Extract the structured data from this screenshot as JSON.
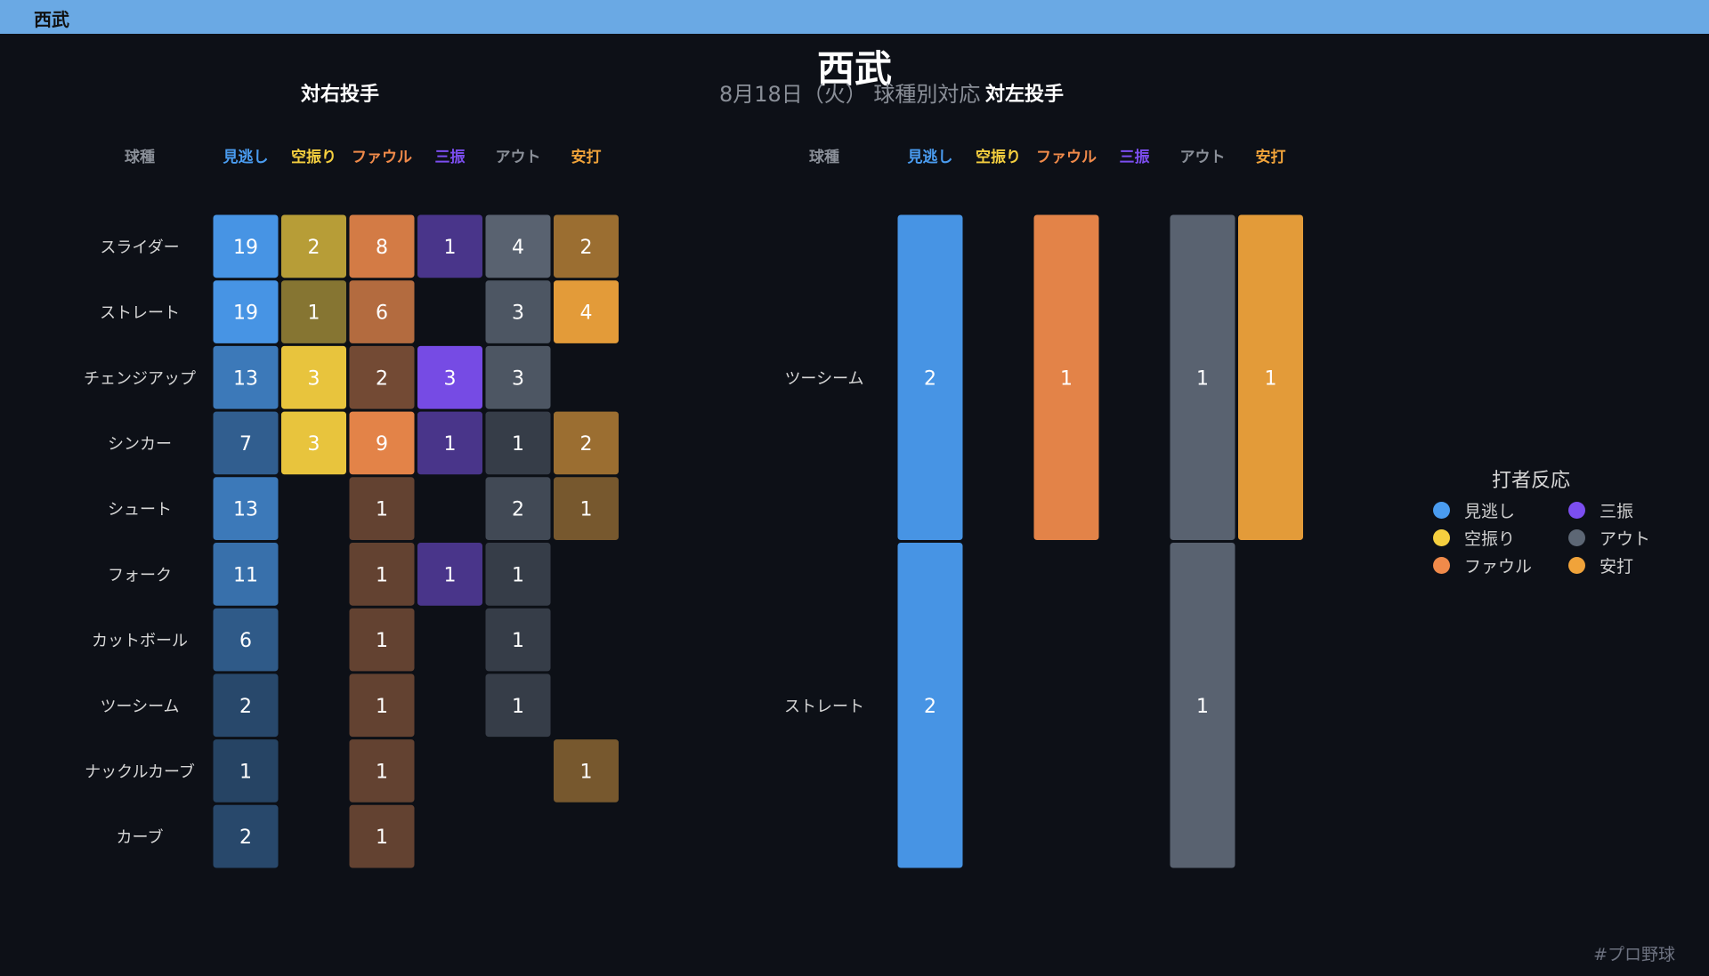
{
  "header": {
    "team_label": "西武"
  },
  "title": "西武",
  "subtitle": "8月18日（火） 球種別対応",
  "footer": {
    "hashtag": "#プロ野球"
  },
  "legend": {
    "title": "打者反応",
    "items": [
      {
        "label": "見逃し",
        "color": "#4a9cf0"
      },
      {
        "label": "三振",
        "color": "#7c4ef0"
      },
      {
        "label": "空振り",
        "color": "#f5cf3f"
      },
      {
        "label": "アウト",
        "color": "#5d6775"
      },
      {
        "label": "ファウル",
        "color": "#f08a4a"
      },
      {
        "label": "安打",
        "color": "#f0a33a"
      }
    ]
  },
  "chart_data": [
    {
      "type": "heatmap",
      "title": "対右投手",
      "row_header": "球種",
      "columns": [
        {
          "label": "見逃し",
          "color": "#4a9cf0"
        },
        {
          "label": "空振り",
          "color": "#f5cf3f"
        },
        {
          "label": "ファウル",
          "color": "#f08a4a"
        },
        {
          "label": "三振",
          "color": "#7c4ef0"
        },
        {
          "label": "アウト",
          "color": "#5d6775"
        },
        {
          "label": "安打",
          "color": "#f0a33a"
        }
      ],
      "rows": [
        "スライダー",
        "ストレート",
        "チェンジアップ",
        "シンカー",
        "シュート",
        "フォーク",
        "カットボール",
        "ツーシーム",
        "ナックルカーブ",
        "カーブ"
      ],
      "values": [
        [
          19,
          2,
          8,
          1,
          4,
          2
        ],
        [
          19,
          1,
          6,
          null,
          3,
          4
        ],
        [
          13,
          3,
          2,
          3,
          3,
          null
        ],
        [
          7,
          3,
          9,
          1,
          1,
          2
        ],
        [
          13,
          null,
          1,
          null,
          2,
          1
        ],
        [
          11,
          null,
          1,
          1,
          1,
          null
        ],
        [
          6,
          null,
          1,
          null,
          1,
          null
        ],
        [
          2,
          null,
          1,
          null,
          1,
          null
        ],
        [
          1,
          null,
          1,
          null,
          null,
          1
        ],
        [
          2,
          null,
          1,
          null,
          null,
          null
        ]
      ]
    },
    {
      "type": "heatmap",
      "title": "対左投手",
      "row_header": "球種",
      "columns": [
        {
          "label": "見逃し",
          "color": "#4a9cf0"
        },
        {
          "label": "空振り",
          "color": "#f5cf3f"
        },
        {
          "label": "ファウル",
          "color": "#f08a4a"
        },
        {
          "label": "三振",
          "color": "#7c4ef0"
        },
        {
          "label": "アウト",
          "color": "#5d6775"
        },
        {
          "label": "安打",
          "color": "#f0a33a"
        }
      ],
      "rows": [
        "ツーシーム",
        "ストレート"
      ],
      "values": [
        [
          2,
          null,
          1,
          null,
          1,
          1
        ],
        [
          2,
          null,
          null,
          null,
          1,
          null
        ]
      ]
    }
  ]
}
